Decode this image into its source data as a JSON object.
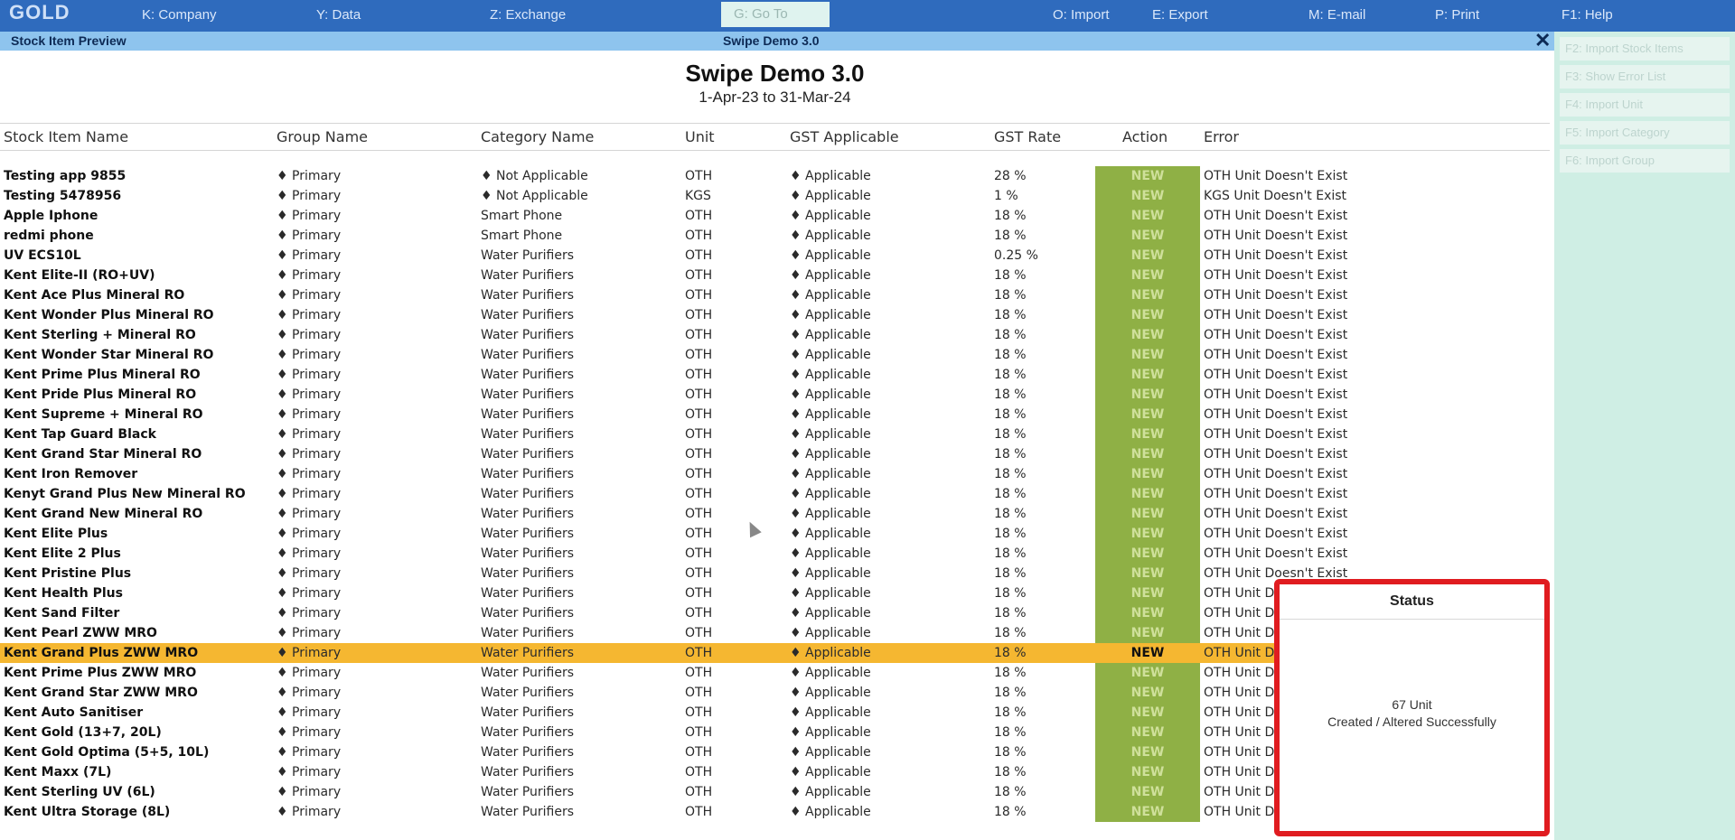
{
  "topbar": {
    "logo": "GOLD",
    "menu": [
      {
        "label": "K: Company"
      },
      {
        "label": "Y: Data"
      },
      {
        "label": "Z: Exchange"
      },
      {
        "label": "G: Go To"
      },
      {
        "label": "O: Import"
      },
      {
        "label": "E: Export"
      },
      {
        "label": "M: E-mail"
      },
      {
        "label": "P: Print"
      },
      {
        "label": "F1: Help"
      }
    ]
  },
  "subbar": {
    "left": "Stock Item Preview",
    "center": "Swipe Demo 3.0",
    "close": "✕"
  },
  "rightpanel": {
    "buttons": [
      {
        "label": "F2: Import Stock Items"
      },
      {
        "label": "F3: Show Error List"
      },
      {
        "label": "F4: Import Unit"
      },
      {
        "label": "F5: Import Category"
      },
      {
        "label": "F6: Import Group"
      }
    ]
  },
  "report": {
    "title": "Swipe Demo 3.0",
    "period": "1-Apr-23 to 31-Mar-24"
  },
  "columns": [
    "Stock Item Name",
    "Group Name",
    "Category Name",
    "Unit",
    "GST Applicable",
    "GST Rate",
    "Action",
    "Error"
  ],
  "rows": [
    {
      "name": "Testing app 9855",
      "group": "♦ Primary",
      "cat": "♦ Not Applicable",
      "unit": "OTH",
      "gst": "♦ Applicable",
      "rate": "28 %",
      "action": "NEW",
      "err": "OTH Unit Doesn't Exist"
    },
    {
      "name": "Testing 5478956",
      "group": "♦ Primary",
      "cat": "♦ Not Applicable",
      "unit": "KGS",
      "gst": "♦ Applicable",
      "rate": "1 %",
      "action": "NEW",
      "err": "KGS Unit Doesn't Exist"
    },
    {
      "name": "Apple Iphone",
      "group": "♦ Primary",
      "cat": "Smart Phone",
      "unit": "OTH",
      "gst": "♦ Applicable",
      "rate": "18 %",
      "action": "NEW",
      "err": "OTH Unit Doesn't Exist"
    },
    {
      "name": "redmi phone",
      "group": "♦ Primary",
      "cat": "Smart Phone",
      "unit": "OTH",
      "gst": "♦ Applicable",
      "rate": "18 %",
      "action": "NEW",
      "err": "OTH Unit Doesn't Exist"
    },
    {
      "name": "UV ECS10L",
      "group": "♦ Primary",
      "cat": "Water Purifiers",
      "unit": "OTH",
      "gst": "♦ Applicable",
      "rate": "0.25 %",
      "action": "NEW",
      "err": "OTH Unit Doesn't Exist"
    },
    {
      "name": "Kent Elite-II (RO+UV)",
      "group": "♦ Primary",
      "cat": "Water Purifiers",
      "unit": "OTH",
      "gst": "♦ Applicable",
      "rate": "18 %",
      "action": "NEW",
      "err": "OTH Unit Doesn't Exist"
    },
    {
      "name": "Kent Ace Plus Mineral RO",
      "group": "♦ Primary",
      "cat": "Water Purifiers",
      "unit": "OTH",
      "gst": "♦ Applicable",
      "rate": "18 %",
      "action": "NEW",
      "err": "OTH Unit Doesn't Exist"
    },
    {
      "name": "Kent Wonder Plus Mineral RO",
      "group": "♦ Primary",
      "cat": "Water Purifiers",
      "unit": "OTH",
      "gst": "♦ Applicable",
      "rate": "18 %",
      "action": "NEW",
      "err": "OTH Unit Doesn't Exist"
    },
    {
      "name": "Kent Sterling + Mineral RO",
      "group": "♦ Primary",
      "cat": "Water Purifiers",
      "unit": "OTH",
      "gst": "♦ Applicable",
      "rate": "18 %",
      "action": "NEW",
      "err": "OTH Unit Doesn't Exist"
    },
    {
      "name": "Kent Wonder Star Mineral RO",
      "group": "♦ Primary",
      "cat": "Water Purifiers",
      "unit": "OTH",
      "gst": "♦ Applicable",
      "rate": "18 %",
      "action": "NEW",
      "err": "OTH Unit Doesn't Exist"
    },
    {
      "name": "Kent Prime Plus Mineral RO",
      "group": "♦ Primary",
      "cat": "Water Purifiers",
      "unit": "OTH",
      "gst": "♦ Applicable",
      "rate": "18 %",
      "action": "NEW",
      "err": "OTH Unit Doesn't Exist"
    },
    {
      "name": "Kent Pride Plus Mineral RO",
      "group": "♦ Primary",
      "cat": "Water Purifiers",
      "unit": "OTH",
      "gst": "♦ Applicable",
      "rate": "18 %",
      "action": "NEW",
      "err": "OTH Unit Doesn't Exist"
    },
    {
      "name": "Kent Supreme + Mineral RO",
      "group": "♦ Primary",
      "cat": "Water Purifiers",
      "unit": "OTH",
      "gst": "♦ Applicable",
      "rate": "18 %",
      "action": "NEW",
      "err": "OTH Unit Doesn't Exist"
    },
    {
      "name": "Kent Tap Guard Black",
      "group": "♦ Primary",
      "cat": "Water Purifiers",
      "unit": "OTH",
      "gst": "♦ Applicable",
      "rate": "18 %",
      "action": "NEW",
      "err": "OTH Unit Doesn't Exist"
    },
    {
      "name": "Kent Grand Star Mineral RO",
      "group": "♦ Primary",
      "cat": "Water Purifiers",
      "unit": "OTH",
      "gst": "♦ Applicable",
      "rate": "18 %",
      "action": "NEW",
      "err": "OTH Unit Doesn't Exist"
    },
    {
      "name": "Kent Iron Remover",
      "group": "♦ Primary",
      "cat": "Water Purifiers",
      "unit": "OTH",
      "gst": "♦ Applicable",
      "rate": "18 %",
      "action": "NEW",
      "err": "OTH Unit Doesn't Exist"
    },
    {
      "name": "Kenyt Grand Plus New Mineral RO",
      "group": "♦ Primary",
      "cat": "Water Purifiers",
      "unit": "OTH",
      "gst": "♦ Applicable",
      "rate": "18 %",
      "action": "NEW",
      "err": "OTH Unit Doesn't Exist"
    },
    {
      "name": "Kent Grand New Mineral RO",
      "group": "♦ Primary",
      "cat": "Water Purifiers",
      "unit": "OTH",
      "gst": "♦ Applicable",
      "rate": "18 %",
      "action": "NEW",
      "err": "OTH Unit Doesn't Exist"
    },
    {
      "name": "Kent Elite Plus",
      "group": "♦ Primary",
      "cat": "Water Purifiers",
      "unit": "OTH",
      "gst": "♦ Applicable",
      "rate": "18 %",
      "action": "NEW",
      "err": "OTH Unit Doesn't Exist"
    },
    {
      "name": "Kent Elite 2 Plus",
      "group": "♦ Primary",
      "cat": "Water Purifiers",
      "unit": "OTH",
      "gst": "♦ Applicable",
      "rate": "18 %",
      "action": "NEW",
      "err": "OTH Unit Doesn't Exist"
    },
    {
      "name": "Kent Pristine Plus",
      "group": "♦ Primary",
      "cat": "Water Purifiers",
      "unit": "OTH",
      "gst": "♦ Applicable",
      "rate": "18 %",
      "action": "NEW",
      "err": "OTH Unit Doesn't Exist"
    },
    {
      "name": "Kent Health Plus",
      "group": "♦ Primary",
      "cat": "Water Purifiers",
      "unit": "OTH",
      "gst": "♦ Applicable",
      "rate": "18 %",
      "action": "NEW",
      "err": "OTH Unit Doesn't Exist"
    },
    {
      "name": "Kent Sand Filter",
      "group": "♦ Primary",
      "cat": "Water Purifiers",
      "unit": "OTH",
      "gst": "♦ Applicable",
      "rate": "18 %",
      "action": "NEW",
      "err": "OTH Unit Doesn't Exist"
    },
    {
      "name": "Kent Pearl ZWW MRO",
      "group": "♦ Primary",
      "cat": "Water Purifiers",
      "unit": "OTH",
      "gst": "♦ Applicable",
      "rate": "18 %",
      "action": "NEW",
      "err": "OTH Unit Doesn't Exist"
    },
    {
      "name": "Kent Grand Plus ZWW MRO",
      "group": "♦ Primary",
      "cat": "Water Purifiers",
      "unit": "OTH",
      "gst": "♦ Applicable",
      "rate": "18 %",
      "action": "NEW",
      "err": "OTH Unit Doesn't Exist"
    },
    {
      "name": "Kent Prime Plus ZWW MRO",
      "group": "♦ Primary",
      "cat": "Water Purifiers",
      "unit": "OTH",
      "gst": "♦ Applicable",
      "rate": "18 %",
      "action": "NEW",
      "err": "OTH Unit Doesn't Exist"
    },
    {
      "name": "Kent Grand Star ZWW MRO",
      "group": "♦ Primary",
      "cat": "Water Purifiers",
      "unit": "OTH",
      "gst": "♦ Applicable",
      "rate": "18 %",
      "action": "NEW",
      "err": "OTH Unit Doesn't Exist"
    },
    {
      "name": "Kent Auto Sanitiser",
      "group": "♦ Primary",
      "cat": "Water Purifiers",
      "unit": "OTH",
      "gst": "♦ Applicable",
      "rate": "18 %",
      "action": "NEW",
      "err": "OTH Unit Doesn't Exist"
    },
    {
      "name": "Kent Gold (13+7, 20L)",
      "group": "♦ Primary",
      "cat": "Water Purifiers",
      "unit": "OTH",
      "gst": "♦ Applicable",
      "rate": "18 %",
      "action": "NEW",
      "err": "OTH Unit Doesn't Exist"
    },
    {
      "name": "Kent Gold Optima (5+5, 10L)",
      "group": "♦ Primary",
      "cat": "Water Purifiers",
      "unit": "OTH",
      "gst": "♦ Applicable",
      "rate": "18 %",
      "action": "NEW",
      "err": "OTH Unit Doesn't Exist"
    },
    {
      "name": "Kent Maxx (7L)",
      "group": "♦ Primary",
      "cat": "Water Purifiers",
      "unit": "OTH",
      "gst": "♦ Applicable",
      "rate": "18 %",
      "action": "NEW",
      "err": "OTH Unit Doesn't Exist"
    },
    {
      "name": "Kent Sterling UV (6L)",
      "group": "♦ Primary",
      "cat": "Water Purifiers",
      "unit": "OTH",
      "gst": "♦ Applicable",
      "rate": "18 %",
      "action": "NEW",
      "err": "OTH Unit Doesn't Exist"
    },
    {
      "name": "Kent Ultra Storage (8L)",
      "group": "♦ Primary",
      "cat": "Water Purifiers",
      "unit": "OTH",
      "gst": "♦ Applicable",
      "rate": "18 %",
      "action": "NEW",
      "err": "OTH Unit Doesn't Exist"
    }
  ],
  "highlighted_row": 24,
  "status_dialog": {
    "title": "Status",
    "line1": "67 Unit",
    "line2": "Created / Altered Successfully"
  },
  "colors": {
    "topbar": "#2f6bbd",
    "subbar": "#8ec4ee",
    "action_cell": "#8fb045",
    "highlight_row": "#f5b731",
    "dialog_border": "#e01c20",
    "right_panel": "#cfeee4"
  }
}
